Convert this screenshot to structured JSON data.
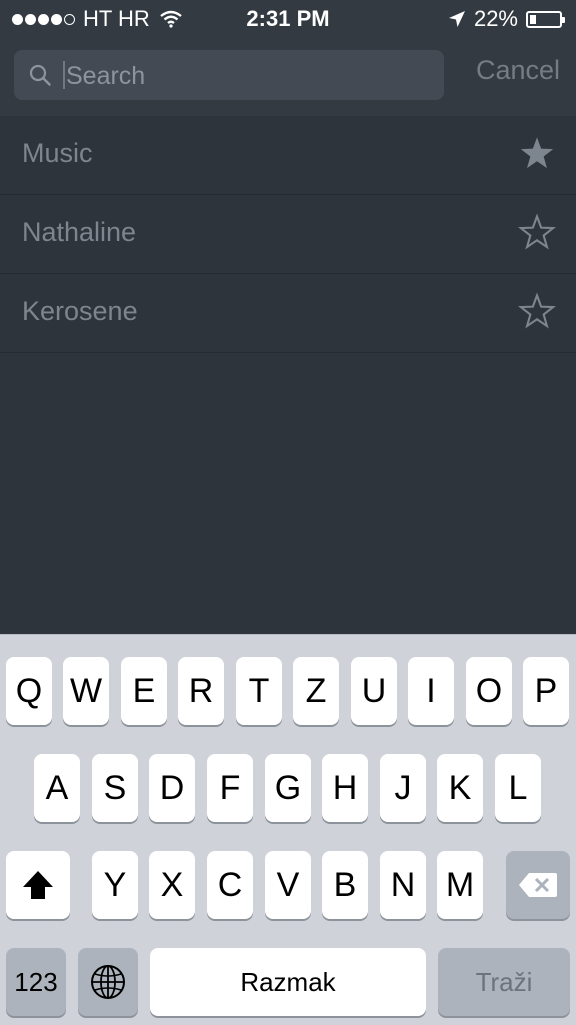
{
  "status_bar": {
    "carrier": "HT HR",
    "time": "2:31 PM",
    "battery": "22%",
    "battery_level": 0.22,
    "signal_bars": 4,
    "signal_total": 5
  },
  "search": {
    "placeholder": "Search",
    "cancel_label": "Cancel"
  },
  "results": [
    {
      "label": "Music",
      "favorite": true
    },
    {
      "label": "Nathaline",
      "favorite": false
    },
    {
      "label": "Kerosene",
      "favorite": false
    }
  ],
  "keyboard": {
    "row1": [
      "Q",
      "W",
      "E",
      "R",
      "T",
      "Z",
      "U",
      "I",
      "O",
      "P"
    ],
    "row2": [
      "A",
      "S",
      "D",
      "F",
      "G",
      "H",
      "J",
      "K",
      "L"
    ],
    "row3": [
      "Y",
      "X",
      "C",
      "V",
      "B",
      "N",
      "M"
    ],
    "numbers_label": "123",
    "space_label": "Razmak",
    "return_label": "Traži"
  },
  "icons": [
    "signal-icon",
    "wifi-icon",
    "location-icon",
    "battery-icon",
    "search-icon",
    "star-filled-icon",
    "star-outline-icon",
    "shift-icon",
    "delete-icon",
    "globe-icon"
  ],
  "colors": {
    "background": "#2e343c",
    "bar": "#333a42",
    "keyboard": "#cfd3d9",
    "dim_text": "#7d858f"
  }
}
